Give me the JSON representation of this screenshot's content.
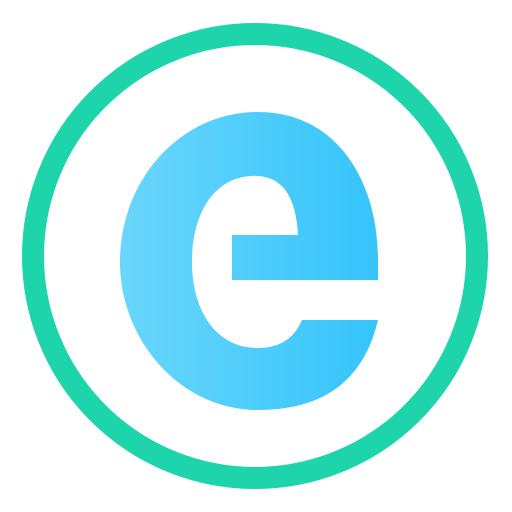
{
  "icon": {
    "name": "e-letter-icon",
    "glyph": "e"
  },
  "colors": {
    "background": "#ffffff",
    "ring": "#1ed4aa",
    "glyph_light": "#6ad6fb",
    "glyph_dark": "#35c4fb"
  }
}
